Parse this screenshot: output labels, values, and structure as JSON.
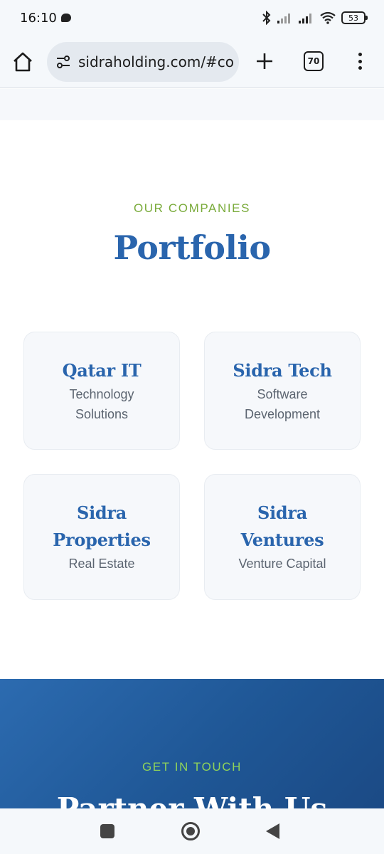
{
  "status_bar": {
    "time": "16:10",
    "battery": "53",
    "icons": [
      "message-icon",
      "bluetooth-icon",
      "signal-icon",
      "signal-icon",
      "wifi-icon",
      "battery-icon"
    ]
  },
  "browser": {
    "url": "sidraholding.com/#co",
    "tab_count": "70",
    "icons": [
      "home-icon",
      "site-settings-icon",
      "plus-icon",
      "tabs-icon",
      "more-vert-icon"
    ]
  },
  "portfolio": {
    "eyebrow": "OUR COMPANIES",
    "title": "Portfolio",
    "companies": [
      {
        "name": "Qatar IT",
        "desc_lines": [
          "Technology",
          "Solutions"
        ]
      },
      {
        "name": "Sidra Tech",
        "desc_lines": [
          "Software",
          "Development"
        ]
      },
      {
        "name_lines": [
          "Sidra",
          "Properties"
        ],
        "desc": "Real Estate"
      },
      {
        "name_lines": [
          "Sidra",
          "Ventures"
        ],
        "desc": "Venture Capital"
      }
    ]
  },
  "contact": {
    "eyebrow": "GET IN TOUCH",
    "title": "Partner With Us"
  },
  "nav_bar": {
    "icons": [
      "recents-icon",
      "home-circle-icon",
      "back-icon"
    ]
  },
  "colors": {
    "accent_blue": "#2a65ad",
    "accent_green": "#7aab3b",
    "contact_bg": "#1f5796"
  }
}
